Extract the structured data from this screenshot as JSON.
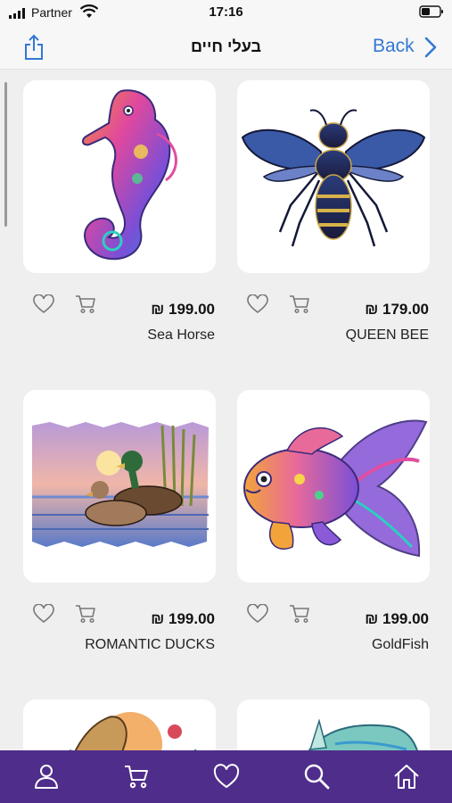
{
  "status": {
    "carrier": "Partner",
    "time": "17:16"
  },
  "header": {
    "title": "בעלי חיים",
    "back_label": "Back"
  },
  "products": [
    {
      "name": "Sea Horse",
      "price": "₪ 199.00"
    },
    {
      "name": "QUEEN BEE",
      "price": "₪ 179.00"
    },
    {
      "name": "ROMANTIC DUCKS",
      "price": "₪ 199.00"
    },
    {
      "name": "GoldFish",
      "price": "₪ 199.00"
    }
  ],
  "tabs": [
    "profile-icon",
    "cart-icon",
    "heart-icon",
    "search-icon",
    "home-icon"
  ],
  "colors": {
    "accent": "#3478d4",
    "tabbar": "#4f2d8a"
  }
}
